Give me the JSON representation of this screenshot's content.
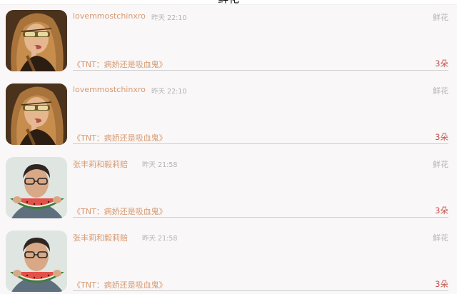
{
  "header": {
    "title": "鲜花"
  },
  "items": [
    {
      "avatar": "woman-with-sunglasses-avatar",
      "username": "lovemmostchinxro",
      "time": "昨天 22:10",
      "kind": "鲜花",
      "book": "《TNT：病娇还是吸血鬼》",
      "count": "3朵"
    },
    {
      "avatar": "woman-with-sunglasses-avatar",
      "username": "lovemmostchinxro",
      "time": "昨天 22:10",
      "kind": "鲜花",
      "book": "《TNT：病娇还是吸血鬼》",
      "count": "3朵"
    },
    {
      "avatar": "man-with-watermelon-avatar",
      "username": "张丰莉和毅莉赔",
      "time": "昨天 21:58",
      "kind": "鲜花",
      "book": "《TNT：病娇还是吸血鬼》",
      "count": "3朵"
    },
    {
      "avatar": "man-with-watermelon-avatar",
      "username": "张丰莉和毅莉赔",
      "time": "昨天 21:58",
      "kind": "鲜花",
      "book": "《TNT：病娇还是吸血鬼》",
      "count": "3朵"
    }
  ],
  "colors": {
    "username": "#d69a70",
    "book_title": "#d89a6f",
    "count": "#c0504a",
    "muted": "#b3b3b3",
    "row_background": "#f9f7f8"
  }
}
